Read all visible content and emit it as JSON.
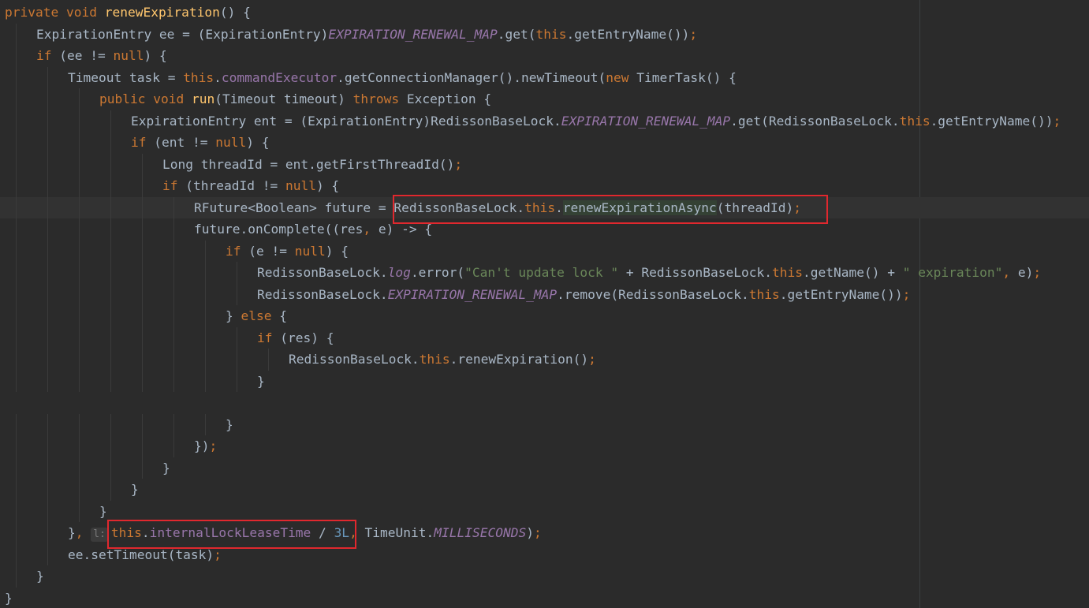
{
  "editor": {
    "lines": [
      {
        "indent": 0,
        "tokens": [
          [
            "kw",
            "private"
          ],
          [
            "p",
            " "
          ],
          [
            "kw",
            "void"
          ],
          [
            "p",
            " "
          ],
          [
            "fn",
            "renewExpiration"
          ],
          [
            "p",
            "() {"
          ]
        ]
      },
      {
        "indent": 1,
        "tokens": [
          [
            "p",
            "ExpirationEntry ee = (ExpirationEntry)"
          ],
          [
            "st",
            "EXPIRATION_RENEWAL_MAP"
          ],
          [
            "p",
            ".get("
          ],
          [
            "kw",
            "this"
          ],
          [
            "p",
            ".getEntryName())"
          ],
          [
            "kw",
            ";"
          ]
        ]
      },
      {
        "indent": 1,
        "tokens": [
          [
            "kw",
            "if"
          ],
          [
            "p",
            " (ee != "
          ],
          [
            "kw",
            "null"
          ],
          [
            "p",
            ") {"
          ]
        ]
      },
      {
        "indent": 2,
        "tokens": [
          [
            "p",
            "Timeout task = "
          ],
          [
            "kw",
            "this"
          ],
          [
            "p",
            "."
          ],
          [
            "fld",
            "commandExecutor"
          ],
          [
            "p",
            ".getConnectionManager().newTimeout("
          ],
          [
            "kw",
            "new"
          ],
          [
            "p",
            " TimerTask() {"
          ]
        ]
      },
      {
        "indent": 3,
        "tokens": [
          [
            "kw",
            "public"
          ],
          [
            "p",
            " "
          ],
          [
            "kw",
            "void"
          ],
          [
            "p",
            " "
          ],
          [
            "fn",
            "run"
          ],
          [
            "p",
            "(Timeout timeout) "
          ],
          [
            "kw",
            "throws"
          ],
          [
            "p",
            " Exception {"
          ]
        ]
      },
      {
        "indent": 4,
        "tokens": [
          [
            "p",
            "ExpirationEntry ent = (ExpirationEntry)RedissonBaseLock."
          ],
          [
            "st",
            "EXPIRATION_RENEWAL_MAP"
          ],
          [
            "p",
            ".get(RedissonBaseLock."
          ],
          [
            "kw",
            "this"
          ],
          [
            "p",
            ".getEntryName())"
          ],
          [
            "kw",
            ";"
          ]
        ]
      },
      {
        "indent": 4,
        "tokens": [
          [
            "kw",
            "if"
          ],
          [
            "p",
            " (ent != "
          ],
          [
            "kw",
            "null"
          ],
          [
            "p",
            ") {"
          ]
        ]
      },
      {
        "indent": 5,
        "tokens": [
          [
            "p",
            "Long threadId = ent.getFirstThreadId()"
          ],
          [
            "kw",
            ";"
          ]
        ]
      },
      {
        "indent": 5,
        "tokens": [
          [
            "kw",
            "if"
          ],
          [
            "p",
            " (threadId != "
          ],
          [
            "kw",
            "null"
          ],
          [
            "p",
            ") {"
          ]
        ]
      },
      {
        "indent": 6,
        "tokens": [
          [
            "p",
            "RFuture<Boolean> future = RedissonBaseLock."
          ],
          [
            "kw",
            "this"
          ],
          [
            "p",
            "."
          ],
          [
            "hl",
            "renewExpirationAsync"
          ],
          [
            "p",
            "(threadId)"
          ],
          [
            "kw",
            ";"
          ]
        ]
      },
      {
        "indent": 6,
        "tokens": [
          [
            "p",
            "future.onComplete((res"
          ],
          [
            "kw",
            ","
          ],
          [
            "p",
            " e) -> {"
          ]
        ]
      },
      {
        "indent": 7,
        "tokens": [
          [
            "kw",
            "if"
          ],
          [
            "p",
            " (e != "
          ],
          [
            "kw",
            "null"
          ],
          [
            "p",
            ") {"
          ]
        ]
      },
      {
        "indent": 8,
        "tokens": [
          [
            "p",
            "RedissonBaseLock."
          ],
          [
            "st",
            "log"
          ],
          [
            "p",
            ".error("
          ],
          [
            "str",
            "\"Can't update lock \""
          ],
          [
            "p",
            " + RedissonBaseLock."
          ],
          [
            "kw",
            "this"
          ],
          [
            "p",
            ".getName() + "
          ],
          [
            "str",
            "\" expiration\""
          ],
          [
            "kw",
            ","
          ],
          [
            "p",
            " e)"
          ],
          [
            "kw",
            ";"
          ]
        ]
      },
      {
        "indent": 8,
        "tokens": [
          [
            "p",
            "RedissonBaseLock."
          ],
          [
            "st",
            "EXPIRATION_RENEWAL_MAP"
          ],
          [
            "p",
            ".remove(RedissonBaseLock."
          ],
          [
            "kw",
            "this"
          ],
          [
            "p",
            ".getEntryName())"
          ],
          [
            "kw",
            ";"
          ]
        ]
      },
      {
        "indent": 7,
        "tokens": [
          [
            "p",
            "} "
          ],
          [
            "kw",
            "else"
          ],
          [
            "p",
            " {"
          ]
        ]
      },
      {
        "indent": 8,
        "tokens": [
          [
            "kw",
            "if"
          ],
          [
            "p",
            " (res) {"
          ]
        ]
      },
      {
        "indent": 9,
        "tokens": [
          [
            "p",
            "RedissonBaseLock."
          ],
          [
            "kw",
            "this"
          ],
          [
            "p",
            ".renewExpiration()"
          ],
          [
            "kw",
            ";"
          ]
        ]
      },
      {
        "indent": 8,
        "tokens": [
          [
            "p",
            "}"
          ]
        ]
      },
      {
        "indent": 0,
        "tokens": []
      },
      {
        "indent": 7,
        "tokens": [
          [
            "p",
            "}"
          ]
        ]
      },
      {
        "indent": 6,
        "tokens": [
          [
            "p",
            "})"
          ],
          [
            "kw",
            ";"
          ]
        ]
      },
      {
        "indent": 5,
        "tokens": [
          [
            "p",
            "}"
          ]
        ]
      },
      {
        "indent": 4,
        "tokens": [
          [
            "p",
            "}"
          ]
        ]
      },
      {
        "indent": 3,
        "tokens": [
          [
            "p",
            "}"
          ]
        ]
      },
      {
        "indent": 2,
        "tokens": [
          [
            "p",
            "}"
          ],
          [
            "kw",
            ","
          ],
          [
            "p",
            " "
          ],
          [
            "hint",
            "l:"
          ],
          [
            "kw",
            "this"
          ],
          [
            "p",
            "."
          ],
          [
            "fld",
            "internalLockLeaseTime"
          ],
          [
            "p",
            " / "
          ],
          [
            "num",
            "3L"
          ],
          [
            "kw",
            ","
          ],
          [
            "p",
            " TimeUnit."
          ],
          [
            "st",
            "MILLISECONDS"
          ],
          [
            "p",
            ")"
          ],
          [
            "kw",
            ";"
          ]
        ]
      },
      {
        "indent": 2,
        "tokens": [
          [
            "p",
            "ee.setTimeout(task)"
          ],
          [
            "kw",
            ";"
          ]
        ]
      },
      {
        "indent": 1,
        "tokens": [
          [
            "p",
            "}"
          ]
        ]
      },
      {
        "indent": 0,
        "tokens": [
          [
            "p",
            "}"
          ]
        ]
      }
    ]
  }
}
